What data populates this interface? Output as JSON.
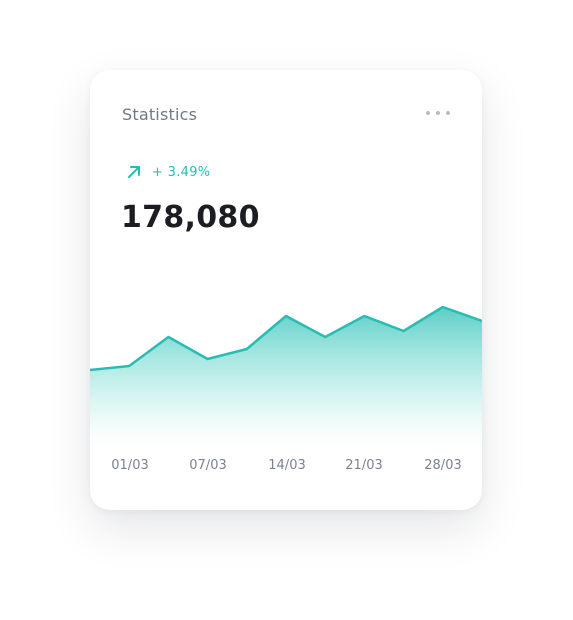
{
  "card": {
    "title": "Statistics",
    "menu_icon": "more-horizontal-icon",
    "change_icon": "arrow-up-right-icon",
    "change_text": "+ 3.49%",
    "total_value": "178,080"
  },
  "colors": {
    "accent": "#27bdb5",
    "value_text": "#1b1d22",
    "muted_text": "#6f7886"
  },
  "chart_data": {
    "type": "area",
    "x_tick_labels": [
      "01/03",
      "07/03",
      "14/03",
      "21/03",
      "28/03"
    ],
    "values": [
      10,
      14,
      43,
      21,
      31,
      64,
      43,
      64,
      49,
      73,
      59
    ],
    "ylim": [
      0,
      100
    ],
    "grid": false,
    "legend": "none"
  }
}
